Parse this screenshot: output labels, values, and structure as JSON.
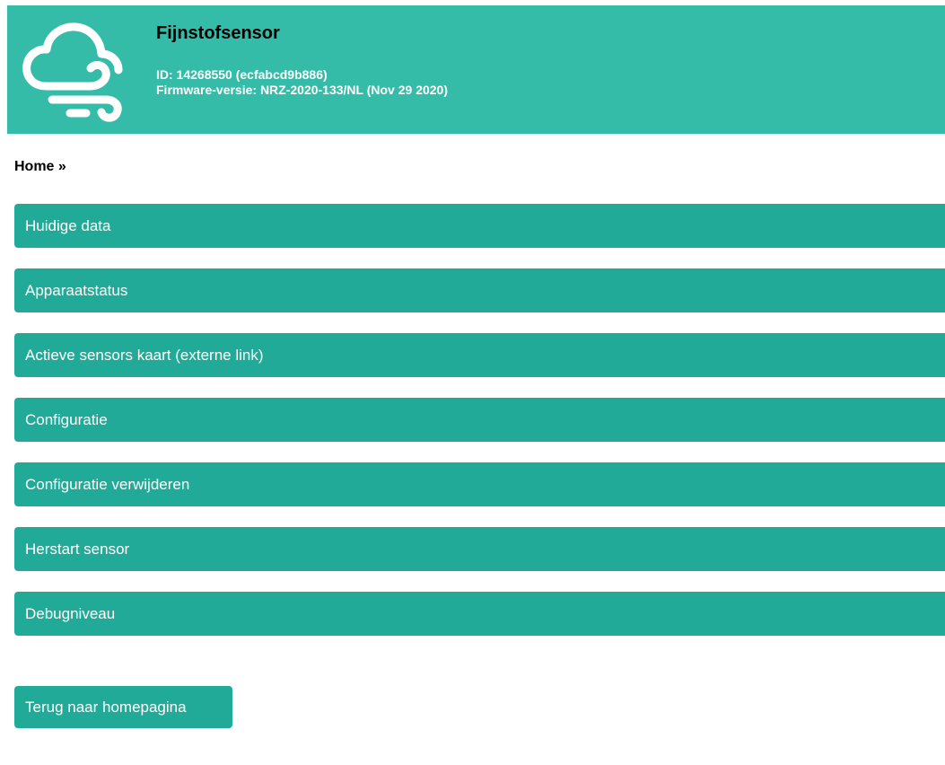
{
  "header": {
    "title": "Fijnstofsensor",
    "id_line": "ID: 14268550 (ecfabcd9b886)",
    "firmware_line": "Firmware-versie: NRZ-2020-133/NL (Nov 29 2020)",
    "logo_icon": "cloud-wind-icon",
    "background_color": "#35bca9"
  },
  "breadcrumb": "Home »",
  "menu": {
    "items": [
      {
        "label": "Huidige data"
      },
      {
        "label": "Apparaatstatus"
      },
      {
        "label": "Actieve sensors kaart (externe link)"
      },
      {
        "label": "Configuratie"
      },
      {
        "label": "Configuratie verwijderen"
      },
      {
        "label": "Herstart sensor"
      },
      {
        "label": "Debugniveau"
      }
    ],
    "button_color": "#22aa99"
  },
  "back_button": {
    "label": "Terug naar homepagina"
  }
}
